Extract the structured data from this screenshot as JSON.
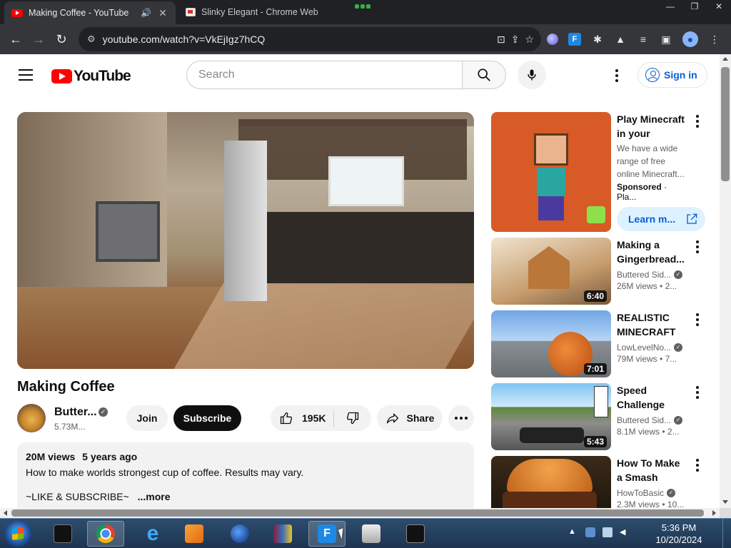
{
  "browser": {
    "tabs": [
      {
        "title": "Making Coffee - YouTube",
        "active": true,
        "favicon": "youtube-favicon"
      },
      {
        "title": "Slinky Elegant - Chrome Web",
        "active": false,
        "favicon": "web-store-favicon"
      }
    ],
    "url": "youtube.com/watch?v=VkEjIgz7hCQ"
  },
  "header": {
    "logo_text": "YouTube",
    "search_placeholder": "Search",
    "sign_in_label": "Sign in"
  },
  "video": {
    "title": "Making Coffee",
    "channel_name": "Butter...",
    "subscribers": "5.73M...",
    "join_label": "Join",
    "subscribe_label": "Subscribe",
    "likes": "195K",
    "share_label": "Share",
    "views": "20M views",
    "age": "5 years ago",
    "description_line1": "How to make worlds strongest cup of coffee. Results may vary.",
    "description_line2": "~LIKE & SUBSCRIBE~",
    "more_label": "...more"
  },
  "sidebar": {
    "ad": {
      "title": "Play Minecraft in your browser",
      "description": "We have a wide range of free online Minecraft...",
      "sponsored_label": "Sponsored",
      "advertiser": "· Pla...",
      "cta_label": "Learn m..."
    },
    "videos": [
      {
        "title": "Making a Gingerbread...",
        "channel": "Buttered Sid...",
        "views": "26M views",
        "age": "• 2...",
        "duration": "6:40",
        "verified": true
      },
      {
        "title": "REALISTIC MINECRAFT -...",
        "channel": "LowLevelNo...",
        "views": "79M views",
        "age": "• 7...",
        "duration": "7:01",
        "verified": true
      },
      {
        "title": "Speed Challenge",
        "channel": "Buttered Sid...",
        "views": "8.1M views",
        "age": "• 2...",
        "duration": "5:43",
        "verified": true
      },
      {
        "title": "How To Make a Smash Burger",
        "channel": "HowToBasic",
        "views": "2.3M views",
        "age": "• 10...",
        "duration": "",
        "verified": true
      }
    ]
  },
  "taskbar": {
    "time": "5:36 PM",
    "date": "10/20/2024"
  },
  "colors": {
    "brand_red": "#ff0000",
    "link_blue": "#065fd4",
    "chrome_dark": "#202124"
  }
}
